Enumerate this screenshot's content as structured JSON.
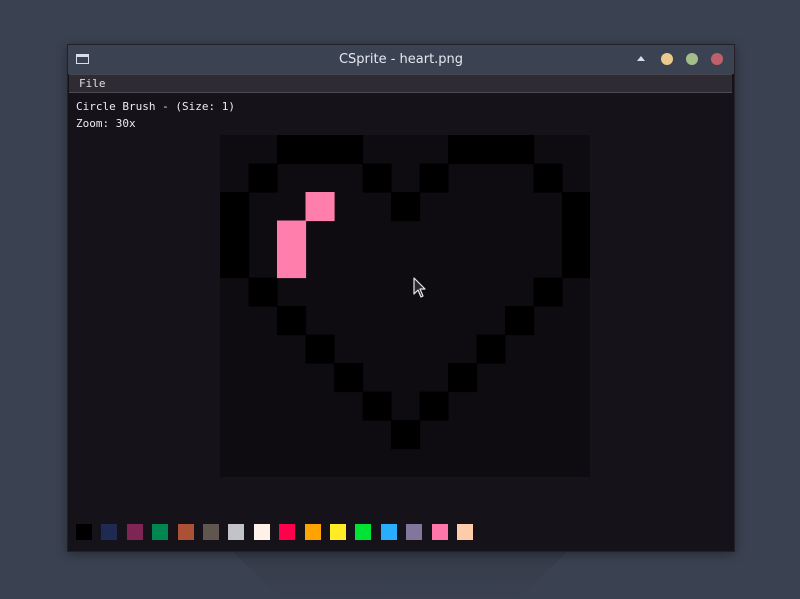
{
  "window": {
    "title": "CSprite - heart.png",
    "controls": {
      "up_color": "#d8dee9",
      "minimize_color": "#ebcb8b",
      "maximize_color": "#a3be8c",
      "close_color": "#bf616a"
    }
  },
  "menu": {
    "file_label": "File"
  },
  "status": {
    "brush_text": "Circle Brush - (Size: 1)",
    "zoom_text": "Zoom: 30x"
  },
  "canvas": {
    "file": "heart.png",
    "pixels_wide": 13,
    "pixels_high": 12,
    "background_color": "#0e0c11",
    "outline_color": "#000000",
    "paint_color": "#ff7eab",
    "outline_rows": [
      "..XXX...XXX..",
      ".X...X.X...X.",
      "X.....X.....X",
      "X...........X",
      "X...........X",
      ".X.........X.",
      "..X.......X..",
      "...X.....X...",
      "....X...X....",
      ".....X.X.....",
      "......X......",
      "............."
    ],
    "painted_pixels": [
      [
        3,
        2
      ],
      [
        2,
        3
      ],
      [
        2,
        4
      ]
    ]
  },
  "palette": {
    "colors": [
      "#000000",
      "#1d2b53",
      "#7e2553",
      "#008751",
      "#ab5236",
      "#5f574f",
      "#c2c3c7",
      "#fff1e8",
      "#ff004d",
      "#ffa300",
      "#ffec27",
      "#00e436",
      "#29adff",
      "#83769c",
      "#ff77a8",
      "#ffccaa"
    ],
    "selected_index": 14
  }
}
